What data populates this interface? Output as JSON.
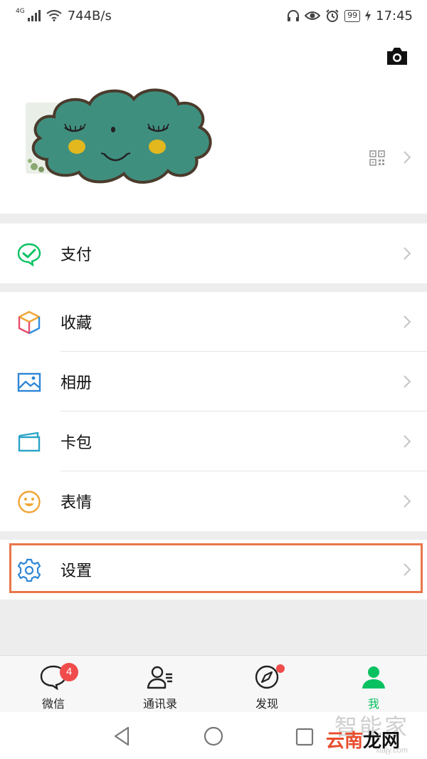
{
  "status_bar": {
    "network": "4G",
    "speed": "744B/s",
    "battery": "99",
    "time": "17:45"
  },
  "menu": {
    "pay": "支付",
    "favorites": "收藏",
    "album": "相册",
    "cards": "卡包",
    "stickers": "表情",
    "settings": "设置"
  },
  "tabs": {
    "chats": "微信",
    "chats_badge": "4",
    "contacts": "通讯录",
    "discover": "发现",
    "me": "我"
  },
  "watermark": {
    "line1": "智能家",
    "line2_red": "云南",
    "line2_black": "龙网",
    "line3": "xiajy.com"
  },
  "colors": {
    "accent_green": "#07c160",
    "badge_red": "#f04c4c",
    "highlight": "#e8764a",
    "avatar_cloud": "#3f8f7f"
  }
}
